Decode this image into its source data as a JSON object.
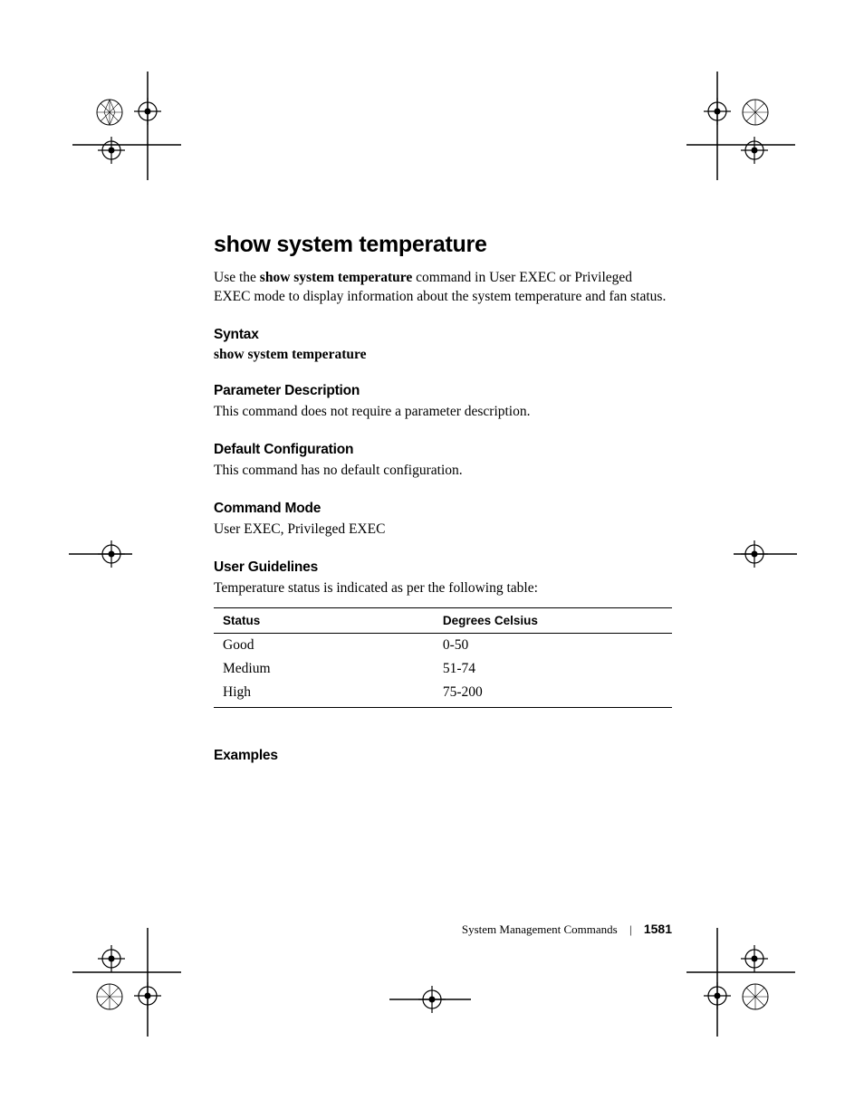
{
  "title": "show system temperature",
  "intro": {
    "prefix": "Use the ",
    "command": "show system temperature",
    "suffix": " command in User EXEC or Privileged EXEC mode to display information about the system temperature and fan status."
  },
  "sections": {
    "syntax": {
      "heading": "Syntax",
      "command": "show system temperature"
    },
    "parameter": {
      "heading": "Parameter Description",
      "body": "This command does not require a parameter description."
    },
    "default": {
      "heading": "Default Configuration",
      "body": "This command has no default configuration."
    },
    "mode": {
      "heading": "Command Mode",
      "body": "User EXEC, Privileged EXEC"
    },
    "guidelines": {
      "heading": "User Guidelines",
      "body": "Temperature status is indicated as per the following table:"
    },
    "examples": {
      "heading": "Examples"
    }
  },
  "table": {
    "headers": {
      "status": "Status",
      "degrees": "Degrees Celsius"
    },
    "rows": [
      {
        "status": "Good",
        "degrees": "0-50"
      },
      {
        "status": "Medium",
        "degrees": "51-74"
      },
      {
        "status": "High",
        "degrees": "75-200"
      }
    ]
  },
  "footer": {
    "chapter": "System Management Commands",
    "page": "1581"
  }
}
